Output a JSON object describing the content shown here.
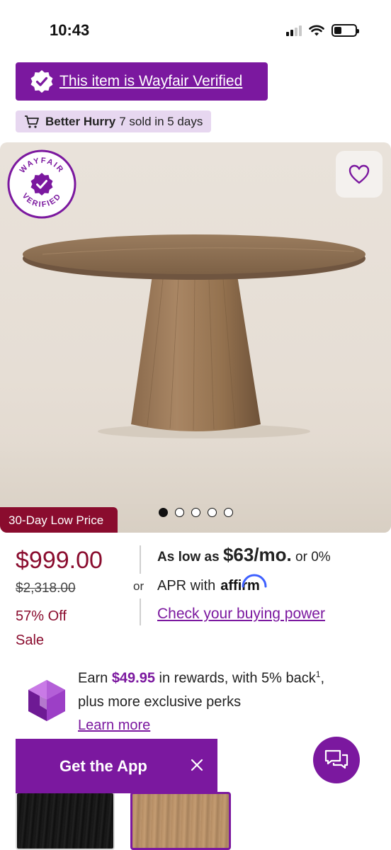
{
  "status_bar": {
    "time": "10:43"
  },
  "verified_banner": {
    "label": "This item is Wayfair Verified",
    "icon": "verified-check-icon"
  },
  "hurry": {
    "bold": "Better Hurry",
    "detail": "7 sold in 5 days",
    "icon": "cart-icon"
  },
  "hero": {
    "badge_text_top": "WAYFAIR",
    "badge_text_bottom": "VERIFIED",
    "favorite_icon": "heart-icon",
    "image_subject": "round pedestal dining table",
    "carousel_count": 5,
    "carousel_active": 0,
    "low_price_tag": "30-Day Low Price"
  },
  "pricing": {
    "price": "$999.00",
    "was_price": "$2,318.00",
    "percent_off": "57% Off",
    "sale_label": "Sale",
    "or_label": "or"
  },
  "financing": {
    "prefix": "As low as",
    "monthly": "$63/mo.",
    "suffix": "or 0%",
    "line2": "APR with",
    "provider": "affirm",
    "buying_power_link": "Check your buying power"
  },
  "rewards": {
    "earn": "Earn",
    "amount": "$49.95",
    "line1_rest": "in rewards, with 5% back",
    "footnote": "1",
    "line1_end": ",",
    "line2": "plus more exclusive perks",
    "learn_more": "Learn more",
    "icon": "gem-icon"
  },
  "get_app": {
    "label": "Get the App",
    "close_icon": "close-icon"
  },
  "chat": {
    "icon": "chat-icon"
  },
  "colors": {
    "brand_purple": "#7b189f",
    "sale_red": "#8a0c2e",
    "hurry_bg": "#e7d7f0"
  }
}
